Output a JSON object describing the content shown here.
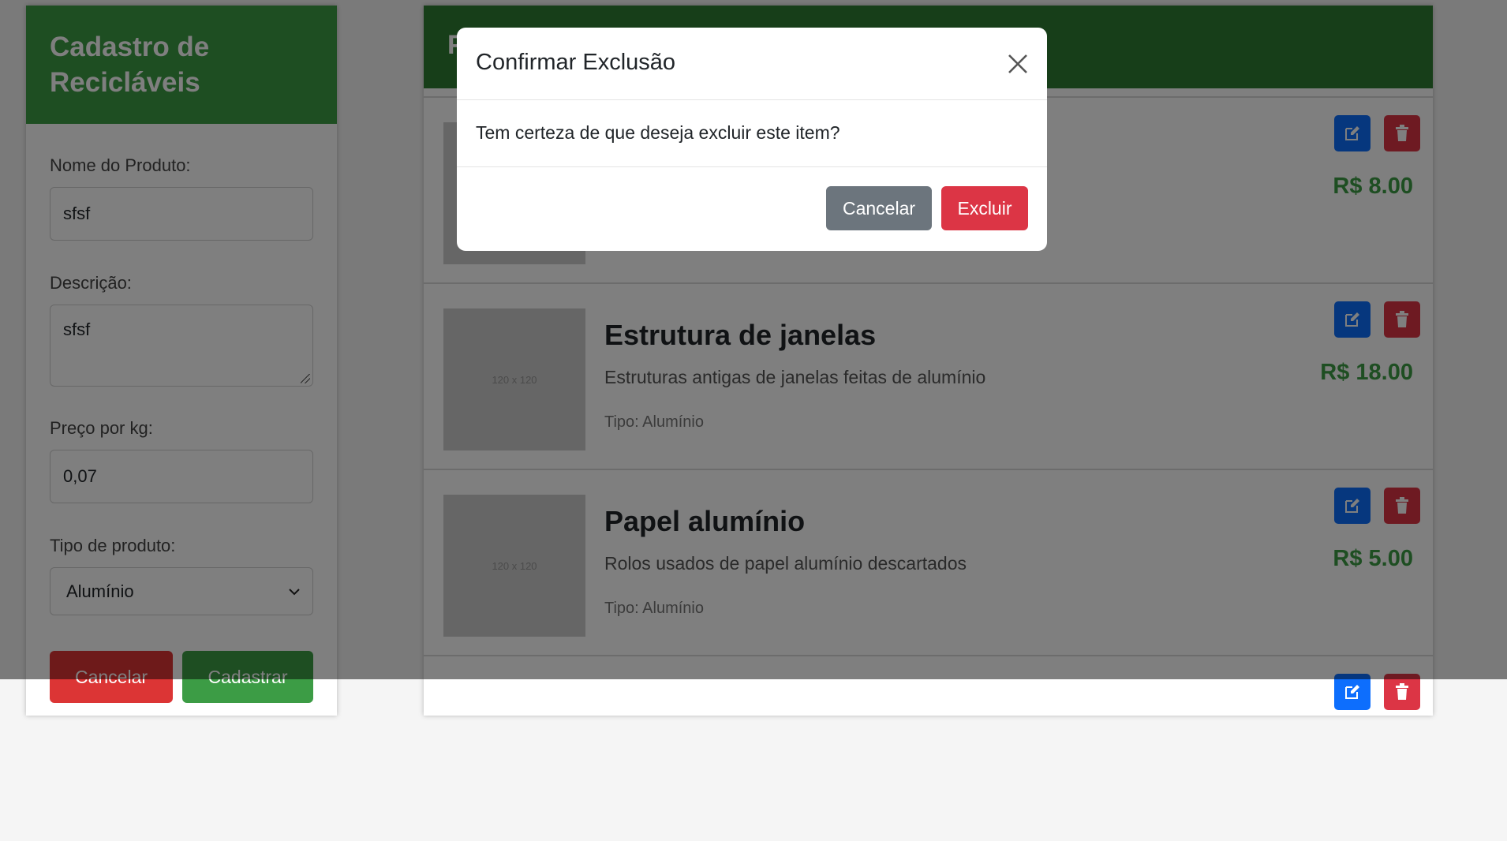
{
  "form": {
    "title": "Cadastro de Recicláveis",
    "name_label": "Nome do Produto:",
    "name_value": "sfsf",
    "desc_label": "Descrição:",
    "desc_value": "sfsf",
    "price_label": "Preço por kg:",
    "price_value": "0,07",
    "type_label": "Tipo de produto:",
    "type_value": "Alumínio",
    "cancel_label": "Cancelar",
    "submit_label": "Cadastrar"
  },
  "list": {
    "title": "P",
    "placeholder_text": "120 x 120",
    "products": [
      {
        "name": "",
        "description": "",
        "type": "",
        "price": "R$ 8.00"
      },
      {
        "name": "Estrutura de janelas",
        "description": "Estruturas antigas de janelas feitas de alumínio",
        "type": "Tipo: Alumínio",
        "price": "R$ 18.00"
      },
      {
        "name": "Papel alumínio",
        "description": "Rolos usados de papel alumínio descartados",
        "type": "Tipo: Alumínio",
        "price": "R$ 5.00"
      },
      {
        "name": "",
        "description": "",
        "type": "",
        "price": ""
      }
    ]
  },
  "modal": {
    "title": "Confirmar Exclusão",
    "message": "Tem certeza de que deseja excluir este item?",
    "cancel_label": "Cancelar",
    "delete_label": "Excluir"
  },
  "colors": {
    "form_header": "#3c9c45",
    "list_header": "#2e7d32",
    "price": "#3c9c45",
    "edit_button": "#0d6efd",
    "delete_button": "#dc3545",
    "modal_cancel": "#6c757d"
  },
  "icons": {
    "edit": "pencil-square-icon",
    "delete": "trash-icon",
    "close": "close-icon",
    "select": "chevron-down-icon"
  }
}
